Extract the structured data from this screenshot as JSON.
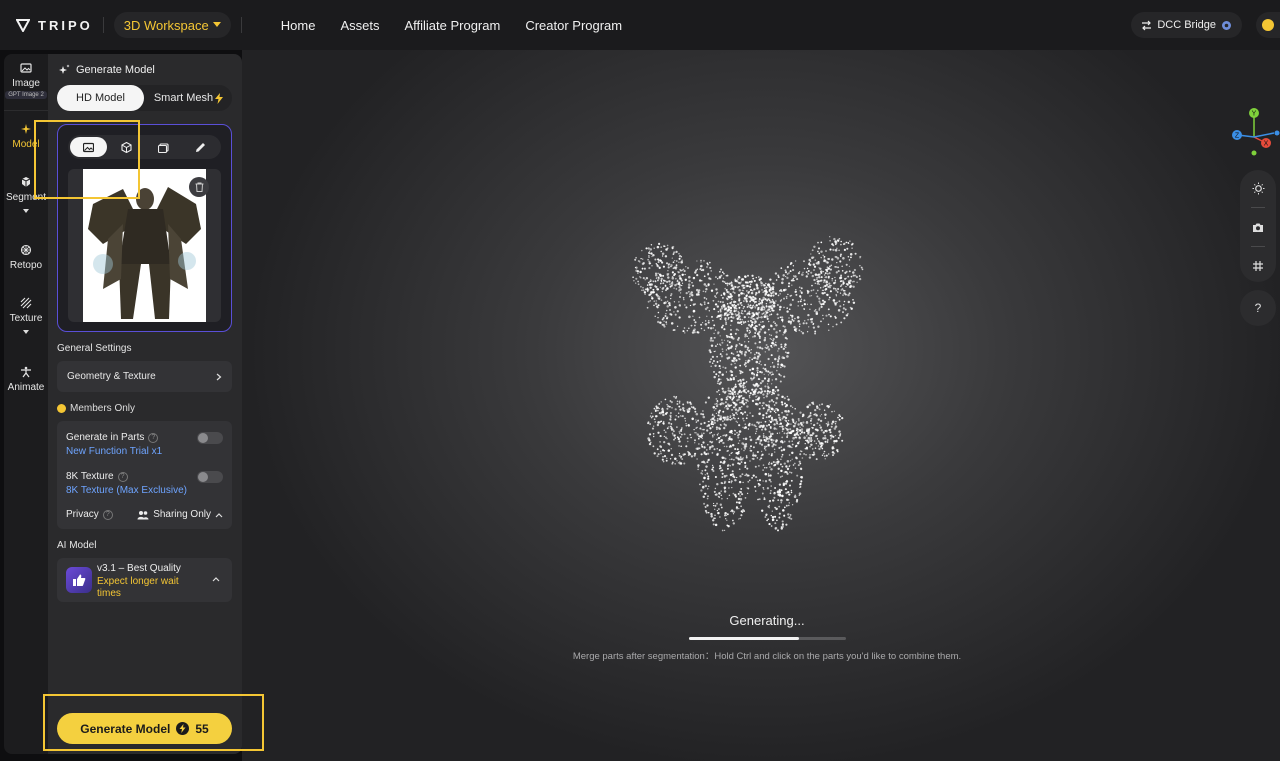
{
  "topbar": {
    "logo_text": "TRIPO",
    "workspace_label": "3D Workspace",
    "nav": [
      "Home",
      "Assets",
      "Affiliate Program",
      "Creator Program"
    ],
    "dcc_label": "DCC Bridge"
  },
  "rail": {
    "items": [
      {
        "label": "Image",
        "icon": "image-icon",
        "badge": "GPT Image 2"
      },
      {
        "label": "Model",
        "icon": "sparkle-icon"
      },
      {
        "label": "Segment",
        "icon": "cubes-icon"
      },
      {
        "label": "Retopo",
        "icon": "mesh-icon"
      },
      {
        "label": "Texture",
        "icon": "texture-icon"
      },
      {
        "label": "Animate",
        "icon": "figure-icon"
      }
    ],
    "active": "Model"
  },
  "panel": {
    "title": "Generate Model",
    "modes": {
      "hd": "HD Model",
      "smart": "Smart Mesh"
    },
    "upload_tabs": [
      "image-icon",
      "cube-icon",
      "multi-image-icon",
      "pencil-icon"
    ],
    "general_settings_label": "General Settings",
    "geometry_texture_label": "Geometry & Texture",
    "members_only_label": "Members Only",
    "generate_parts": {
      "label": "Generate in Parts",
      "sub": "New Function Trial x1",
      "enabled": false
    },
    "texture_8k": {
      "label": "8K Texture",
      "sub": "8K Texture (Max Exclusive)",
      "enabled": false
    },
    "privacy": {
      "label": "Privacy",
      "value": "Sharing Only"
    },
    "ai_model_label": "AI Model",
    "ai_model": {
      "name": "v3.1 – Best Quality",
      "note": "Expect longer wait times"
    },
    "generate_button": {
      "label": "Generate Model",
      "cost": "55"
    }
  },
  "viewport": {
    "status": "Generating...",
    "progress": 0.7,
    "hint": "Merge parts after segmentation：Hold Ctrl and click on the parts you'd like to combine them.",
    "gizmo": {
      "y": "Y",
      "z": "Z",
      "x": "X"
    },
    "help": "?"
  },
  "colors": {
    "accent": "#f4c634",
    "upload_border": "#5a4fd8",
    "link_blue": "#6ea4ff"
  }
}
